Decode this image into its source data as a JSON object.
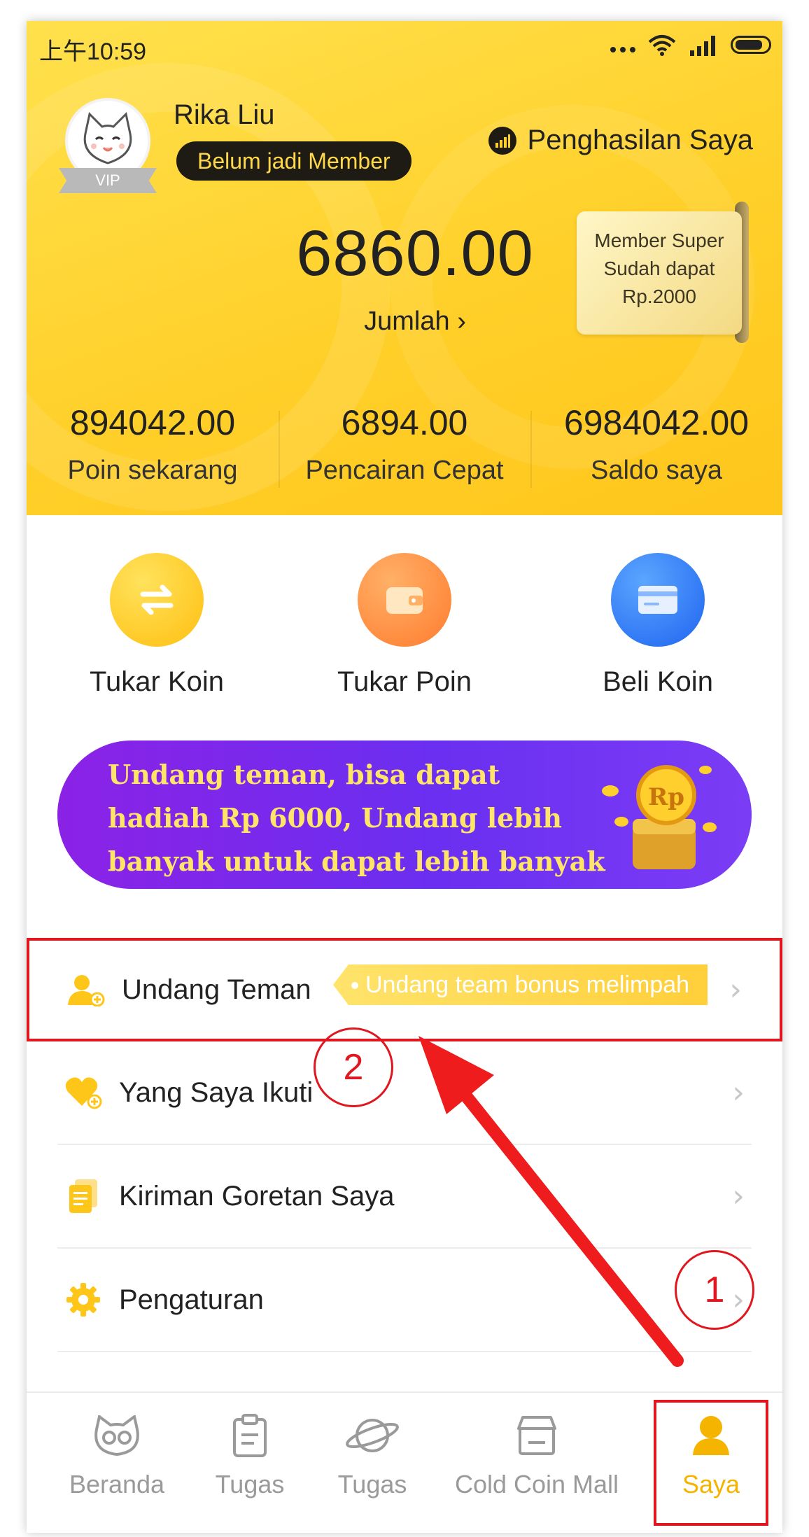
{
  "status_bar": {
    "time": "上午10:59"
  },
  "profile": {
    "name": "Rika Liu",
    "vip_label": "VIP",
    "member_status": "Belum jadi Member",
    "earnings_label": "Penghasilan Saya"
  },
  "balance": {
    "amount": "6860.00",
    "link_label": "Jumlah ›"
  },
  "super_card": {
    "line1": "Member Super",
    "line2": "Sudah dapat",
    "line3": "Rp.2000"
  },
  "stats": [
    {
      "value": "894042.00",
      "label": "Poin sekarang"
    },
    {
      "value": "6894.00",
      "label": "Pencairan Cepat"
    },
    {
      "value": "6984042.00",
      "label": "Saldo saya"
    }
  ],
  "actions": [
    {
      "label": "Tukar Koin",
      "color": "#ffc61a",
      "icon": "exchange-icon"
    },
    {
      "label": "Tukar Poin",
      "color": "#ff8c3a",
      "icon": "wallet-icon"
    },
    {
      "label": "Beli Koin",
      "color": "#2f7cf6",
      "icon": "card-icon"
    }
  ],
  "banner": {
    "line1": "Undang teman, bisa dapat",
    "line2": "hadiah Rp 6000, Undang lebih",
    "line3": "banyak untuk dapat lebih banyak hadiah",
    "coin_text": "Rp"
  },
  "menu": [
    {
      "label": "Undang Teman",
      "tag": "Undang team bonus melimpah",
      "icon": "add-user-icon"
    },
    {
      "label": "Yang Saya Ikuti",
      "icon": "heart-plus-icon"
    },
    {
      "label": "Kiriman Goretan Saya",
      "icon": "documents-icon"
    },
    {
      "label": "Pengaturan",
      "icon": "gear-icon"
    }
  ],
  "annotations": {
    "step1": "1",
    "step2": "2"
  },
  "tabs": [
    {
      "label": "Beranda",
      "icon": "cat-face-icon"
    },
    {
      "label": "Tugas",
      "icon": "clipboard-icon"
    },
    {
      "label": "Tugas",
      "icon": "planet-icon"
    },
    {
      "label": "Cold Coin Mall",
      "icon": "store-icon"
    },
    {
      "label": "Saya",
      "icon": "person-icon"
    }
  ],
  "colors": {
    "accent": "#ffd02a",
    "annotation_red": "#e0171f",
    "active_tab": "#f5b400"
  },
  "chevron": "›"
}
